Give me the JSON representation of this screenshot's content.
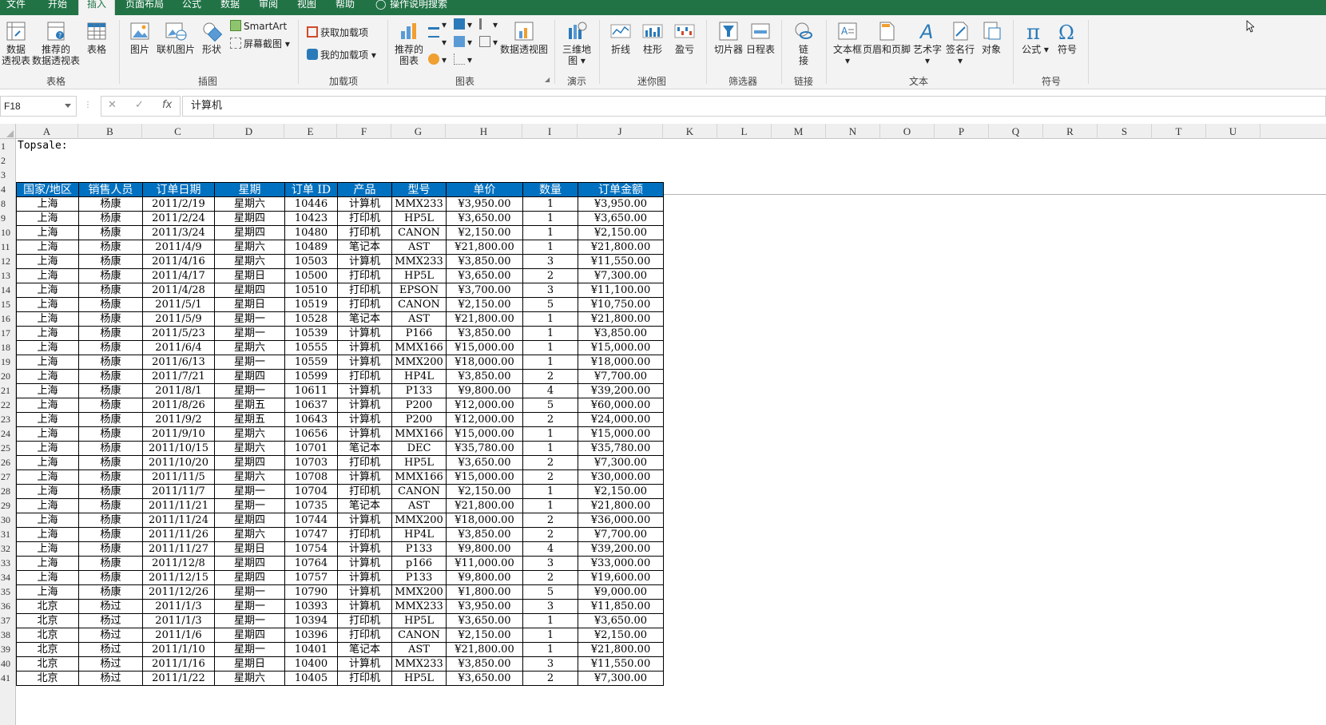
{
  "menu": {
    "tabs": [
      "文件",
      "开始",
      "插入",
      "页面布局",
      "公式",
      "数据",
      "审阅",
      "视图",
      "帮助"
    ],
    "tell_me": "操作说明搜索",
    "active": "插入"
  },
  "ribbon": {
    "groups": [
      "表格",
      "插图",
      "加载项",
      "图表",
      "演示",
      "迷你图",
      "筛选器",
      "链接",
      "文本",
      "符号"
    ],
    "buttons": {
      "pivot": "数据\n透视表",
      "rec_pivot": "推荐的\n数据透视表",
      "table": "表格",
      "picture": "图片",
      "online_picture": "联机图片",
      "shapes": "形状",
      "smartart": "SmartArt",
      "screenshot": "屏幕截图",
      "get_addins": "获取加载项",
      "my_addins": "我的加载项",
      "rec_charts": "推荐的\n图表",
      "pivot_chart": "数据透视图",
      "map3d": "三维地\n图",
      "line": "折线",
      "column": "柱形",
      "winloss": "盈亏",
      "slicer": "切片器",
      "timeline": "日程表",
      "link": "链\n接",
      "textbox": "文本框",
      "header_footer": "页眉和页脚",
      "wordart": "艺术字",
      "signature": "签名行",
      "object": "对象",
      "equation": "公式",
      "symbol": "符号"
    }
  },
  "formula_bar": {
    "name_box": "F18",
    "content": "计算机"
  },
  "columns": [
    "A",
    "B",
    "C",
    "D",
    "E",
    "F",
    "G",
    "H",
    "I",
    "J",
    "K",
    "L",
    "M",
    "N",
    "O",
    "P",
    "Q",
    "R",
    "S",
    "T",
    "U"
  ],
  "rows": [
    "1",
    "2",
    "3",
    "4",
    "8",
    "9",
    "10",
    "11",
    "12",
    "13",
    "14",
    "15",
    "16",
    "17",
    "18",
    "19",
    "20",
    "21",
    "22",
    "23",
    "24",
    "25",
    "26",
    "27",
    "28",
    "29",
    "30",
    "31",
    "32",
    "33",
    "34",
    "35",
    "36",
    "37",
    "38",
    "39",
    "40",
    "41"
  ],
  "sheet": {
    "a1": "Topsale:",
    "headers": [
      "国家/地区",
      "销售人员",
      "订单日期",
      "星期",
      "订单 ID",
      "产品",
      "型号",
      "单价",
      "数量",
      "订单金额"
    ],
    "data": [
      [
        "上海",
        "杨康",
        "2011/2/19",
        "星期六",
        "10446",
        "计算机",
        "MMX233",
        "¥3,950.00",
        "1",
        "¥3,950.00"
      ],
      [
        "上海",
        "杨康",
        "2011/2/24",
        "星期四",
        "10423",
        "打印机",
        "HP5L",
        "¥3,650.00",
        "1",
        "¥3,650.00"
      ],
      [
        "上海",
        "杨康",
        "2011/3/24",
        "星期四",
        "10480",
        "打印机",
        "CANON",
        "¥2,150.00",
        "1",
        "¥2,150.00"
      ],
      [
        "上海",
        "杨康",
        "2011/4/9",
        "星期六",
        "10489",
        "笔记本",
        "AST",
        "¥21,800.00",
        "1",
        "¥21,800.00"
      ],
      [
        "上海",
        "杨康",
        "2011/4/16",
        "星期六",
        "10503",
        "计算机",
        "MMX233",
        "¥3,850.00",
        "3",
        "¥11,550.00"
      ],
      [
        "上海",
        "杨康",
        "2011/4/17",
        "星期日",
        "10500",
        "打印机",
        "HP5L",
        "¥3,650.00",
        "2",
        "¥7,300.00"
      ],
      [
        "上海",
        "杨康",
        "2011/4/28",
        "星期四",
        "10510",
        "打印机",
        "EPSON",
        "¥3,700.00",
        "3",
        "¥11,100.00"
      ],
      [
        "上海",
        "杨康",
        "2011/5/1",
        "星期日",
        "10519",
        "打印机",
        "CANON",
        "¥2,150.00",
        "5",
        "¥10,750.00"
      ],
      [
        "上海",
        "杨康",
        "2011/5/9",
        "星期一",
        "10528",
        "笔记本",
        "AST",
        "¥21,800.00",
        "1",
        "¥21,800.00"
      ],
      [
        "上海",
        "杨康",
        "2011/5/23",
        "星期一",
        "10539",
        "计算机",
        "P166",
        "¥3,850.00",
        "1",
        "¥3,850.00"
      ],
      [
        "上海",
        "杨康",
        "2011/6/4",
        "星期六",
        "10555",
        "计算机",
        "MMX166",
        "¥15,000.00",
        "1",
        "¥15,000.00"
      ],
      [
        "上海",
        "杨康",
        "2011/6/13",
        "星期一",
        "10559",
        "计算机",
        "MMX200",
        "¥18,000.00",
        "1",
        "¥18,000.00"
      ],
      [
        "上海",
        "杨康",
        "2011/7/21",
        "星期四",
        "10599",
        "打印机",
        "HP4L",
        "¥3,850.00",
        "2",
        "¥7,700.00"
      ],
      [
        "上海",
        "杨康",
        "2011/8/1",
        "星期一",
        "10611",
        "计算机",
        "P133",
        "¥9,800.00",
        "4",
        "¥39,200.00"
      ],
      [
        "上海",
        "杨康",
        "2011/8/26",
        "星期五",
        "10637",
        "计算机",
        "P200",
        "¥12,000.00",
        "5",
        "¥60,000.00"
      ],
      [
        "上海",
        "杨康",
        "2011/9/2",
        "星期五",
        "10643",
        "计算机",
        "P200",
        "¥12,000.00",
        "2",
        "¥24,000.00"
      ],
      [
        "上海",
        "杨康",
        "2011/9/10",
        "星期六",
        "10656",
        "计算机",
        "MMX166",
        "¥15,000.00",
        "1",
        "¥15,000.00"
      ],
      [
        "上海",
        "杨康",
        "2011/10/15",
        "星期六",
        "10701",
        "笔记本",
        "DEC",
        "¥35,780.00",
        "1",
        "¥35,780.00"
      ],
      [
        "上海",
        "杨康",
        "2011/10/20",
        "星期四",
        "10703",
        "打印机",
        "HP5L",
        "¥3,650.00",
        "2",
        "¥7,300.00"
      ],
      [
        "上海",
        "杨康",
        "2011/11/5",
        "星期六",
        "10708",
        "计算机",
        "MMX166",
        "¥15,000.00",
        "2",
        "¥30,000.00"
      ],
      [
        "上海",
        "杨康",
        "2011/11/7",
        "星期一",
        "10704",
        "打印机",
        "CANON",
        "¥2,150.00",
        "1",
        "¥2,150.00"
      ],
      [
        "上海",
        "杨康",
        "2011/11/21",
        "星期一",
        "10735",
        "笔记本",
        "AST",
        "¥21,800.00",
        "1",
        "¥21,800.00"
      ],
      [
        "上海",
        "杨康",
        "2011/11/24",
        "星期四",
        "10744",
        "计算机",
        "MMX200",
        "¥18,000.00",
        "2",
        "¥36,000.00"
      ],
      [
        "上海",
        "杨康",
        "2011/11/26",
        "星期六",
        "10747",
        "打印机",
        "HP4L",
        "¥3,850.00",
        "2",
        "¥7,700.00"
      ],
      [
        "上海",
        "杨康",
        "2011/11/27",
        "星期日",
        "10754",
        "计算机",
        "P133",
        "¥9,800.00",
        "4",
        "¥39,200.00"
      ],
      [
        "上海",
        "杨康",
        "2011/12/8",
        "星期四",
        "10764",
        "计算机",
        "p166",
        "¥11,000.00",
        "3",
        "¥33,000.00"
      ],
      [
        "上海",
        "杨康",
        "2011/12/15",
        "星期四",
        "10757",
        "计算机",
        "P133",
        "¥9,800.00",
        "2",
        "¥19,600.00"
      ],
      [
        "上海",
        "杨康",
        "2011/12/26",
        "星期一",
        "10790",
        "计算机",
        "MMX200",
        "¥1,800.00",
        "5",
        "¥9,000.00"
      ],
      [
        "北京",
        "杨过",
        "2011/1/3",
        "星期一",
        "10393",
        "计算机",
        "MMX233",
        "¥3,950.00",
        "3",
        "¥11,850.00"
      ],
      [
        "北京",
        "杨过",
        "2011/1/3",
        "星期一",
        "10394",
        "打印机",
        "HP5L",
        "¥3,650.00",
        "1",
        "¥3,650.00"
      ],
      [
        "北京",
        "杨过",
        "2011/1/6",
        "星期四",
        "10396",
        "打印机",
        "CANON",
        "¥2,150.00",
        "1",
        "¥2,150.00"
      ],
      [
        "北京",
        "杨过",
        "2011/1/10",
        "星期一",
        "10401",
        "笔记本",
        "AST",
        "¥21,800.00",
        "1",
        "¥21,800.00"
      ],
      [
        "北京",
        "杨过",
        "2011/1/16",
        "星期日",
        "10400",
        "计算机",
        "MMX233",
        "¥3,850.00",
        "3",
        "¥11,550.00"
      ],
      [
        "北京",
        "杨过",
        "2011/1/22",
        "星期六",
        "10405",
        "打印机",
        "HP5L",
        "¥3,650.00",
        "2",
        "¥7,300.00"
      ]
    ]
  },
  "colors": {
    "accent": "#217346",
    "header_fill": "#0070c0",
    "header_text": "#ffffff"
  }
}
